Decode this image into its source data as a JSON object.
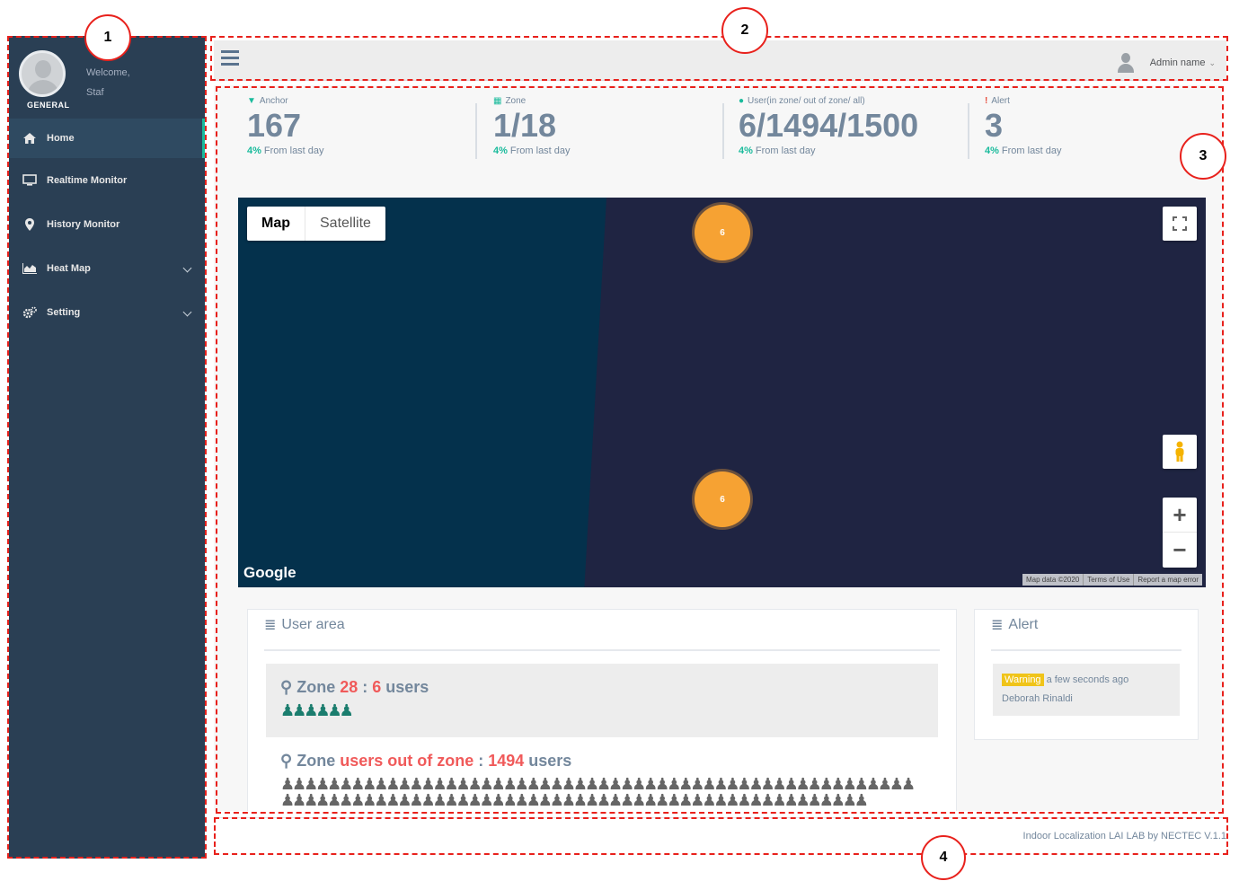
{
  "sidebar": {
    "welcome": "Welcome,",
    "user": "Staf",
    "section": "GENERAL",
    "items": [
      {
        "label": "Home",
        "icon": "home-icon"
      },
      {
        "label": "Realtime Monitor",
        "icon": "monitor-icon"
      },
      {
        "label": "History Monitor",
        "icon": "map-pin-icon"
      },
      {
        "label": "Heat Map",
        "icon": "area-chart-icon"
      },
      {
        "label": "Setting",
        "icon": "gears-icon"
      }
    ]
  },
  "topbar": {
    "admin_name": "Admin name",
    "caret": "⌄"
  },
  "stats": [
    {
      "label": "Anchor",
      "icon": "wifi-icon",
      "value": "167",
      "delta": "4%",
      "sub": "From last day"
    },
    {
      "label": "Zone",
      "icon": "grid-icon",
      "value": "1/18",
      "delta": "4%",
      "sub": "From last day"
    },
    {
      "label": "User(in zone/ out of zone/ all)",
      "icon": "user-icon",
      "value": "6/1494/1500",
      "delta": "4%",
      "sub": "From last day"
    },
    {
      "label": "Alert",
      "icon": "exclamation-icon",
      "value": "3",
      "delta": "4%",
      "sub": "From last day"
    }
  ],
  "map": {
    "type_map": "Map",
    "type_satellite": "Satellite",
    "cluster_top": "6",
    "cluster_bottom": "6",
    "google": "Google",
    "footer_data": "Map data ©2020",
    "footer_terms": "Terms of Use",
    "footer_report": "Report a map error",
    "zoom_in": "+",
    "zoom_out": "−"
  },
  "user_area": {
    "title": "User area",
    "zone1_prefix": "Zone ",
    "zone1_id": "28",
    "zone1_sep": " : ",
    "zone1_count": "6",
    "zone1_suffix": " users",
    "zone1_people": "♟♟♟♟♟♟",
    "zone2_prefix": "Zone ",
    "zone2_id": "users out of zone",
    "zone2_sep": " : ",
    "zone2_count": "1494",
    "zone2_suffix": " users"
  },
  "alert_panel": {
    "title": "Alert",
    "badge": "Warning",
    "time": "a few seconds ago",
    "name": "Deborah Rinaldi"
  },
  "footer": {
    "text": "Indoor Localization LAI LAB by NECTEC V.1.1"
  },
  "annotations": [
    "1",
    "2",
    "3",
    "4"
  ],
  "colors": {
    "sidebar_bg": "#2a3f54",
    "accent": "#1abb9c",
    "annotation": "#e8211c",
    "cluster": "#f6a233",
    "zone_highlight": "#f05a5a"
  }
}
